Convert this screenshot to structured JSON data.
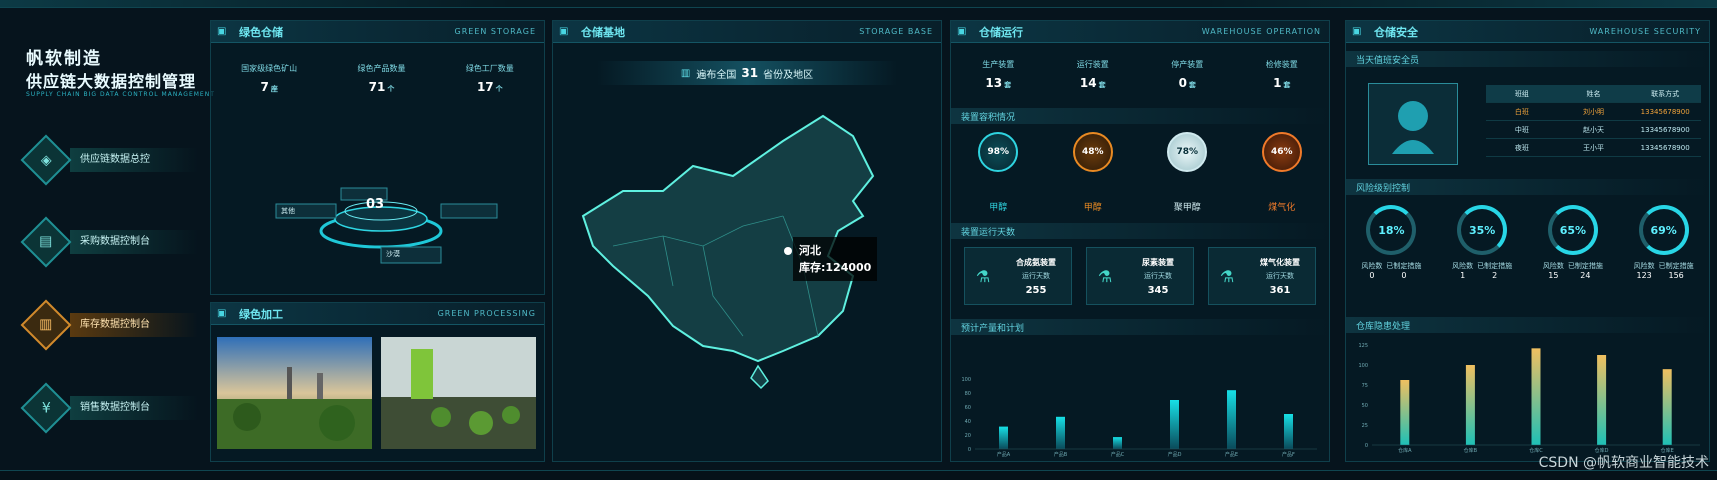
{
  "brand": {
    "name": "帆软制造",
    "title": "供应链大数据控制管理",
    "subtitle": "SUPPLY CHAIN BIG DATA CONTROL MANAGEMENT"
  },
  "nav": [
    {
      "label": "供应链数据总控",
      "icon": "shield-icon",
      "glyph": "◈",
      "active": false
    },
    {
      "label": "采购数据控制台",
      "icon": "document-icon",
      "glyph": "▤",
      "active": false
    },
    {
      "label": "库存数据控制台",
      "icon": "warehouse-icon",
      "glyph": "▥",
      "active": true
    },
    {
      "label": "销售数据控制台",
      "icon": "currency-icon",
      "glyph": "¥",
      "active": false
    }
  ],
  "green_storage": {
    "title": "绿色仓储",
    "title_en": "GREEN STORAGE",
    "stats": [
      {
        "label": "国家级绿色矿山",
        "value": "7",
        "unit": "座"
      },
      {
        "label": "绿色产品数量",
        "value": "71",
        "unit": "个"
      },
      {
        "label": "绿色工厂数量",
        "value": "17",
        "unit": "个"
      }
    ],
    "center_value": "03",
    "tag_left": "其他",
    "tag_right": "",
    "tag_bottom": "沙漠"
  },
  "green_processing": {
    "title": "绿色加工",
    "title_en": "GREEN PROCESSING"
  },
  "storage_base": {
    "title": "仓储基地",
    "title_en": "STORAGE BASE",
    "coverage_prefix": "遍布全国",
    "coverage_count": "31",
    "coverage_suffix": "省份及地区",
    "tooltip_region": "河北",
    "tooltip_stock": "库存:124000"
  },
  "operation": {
    "title": "仓储运行",
    "title_en": "WAREHOUSE OPERATION",
    "stats": [
      {
        "label": "生产装置",
        "value": "13",
        "unit": "套"
      },
      {
        "label": "运行装置",
        "value": "14",
        "unit": "套"
      },
      {
        "label": "停产装置",
        "value": "0",
        "unit": "套"
      },
      {
        "label": "检修装置",
        "value": "1",
        "unit": "套"
      }
    ],
    "capacity_title": "装置容积情况",
    "capacity": [
      {
        "label": "甲醇",
        "pct": "98%",
        "color": "#2fd3df"
      },
      {
        "label": "甲醇",
        "pct": "48%",
        "color": "#e98a23"
      },
      {
        "label": "聚甲醇",
        "pct": "78%",
        "color": "#cfe9ee"
      },
      {
        "label": "煤气化",
        "pct": "46%",
        "color": "#f07a2a"
      }
    ],
    "running_title": "装置运行天数",
    "running": [
      {
        "name": "合成氨装置",
        "label": "运行天数",
        "value": "255"
      },
      {
        "name": "尿素装置",
        "label": "运行天数",
        "value": "345"
      },
      {
        "name": "煤气化装置",
        "label": "运行天数",
        "value": "361"
      }
    ],
    "plan_title": "预计产量和计划"
  },
  "safety": {
    "title": "仓储安全",
    "title_en": "WAREHOUSE SECURITY",
    "officer_title": "当天值班安全员",
    "table_headers": [
      "班组",
      "姓名",
      "联系方式"
    ],
    "table_rows": [
      [
        "白班",
        "刘小明",
        "13345678900"
      ],
      [
        "中班",
        "赵小天",
        "13345678900"
      ],
      [
        "夜班",
        "王小平",
        "13345678900"
      ]
    ],
    "risk_title": "风险级别控制",
    "rings": [
      {
        "pct": "18%",
        "a_label": "风险数",
        "a_val": "0",
        "b_label": "已制定措施",
        "b_val": "0"
      },
      {
        "pct": "35%",
        "a_label": "风险数",
        "a_val": "1",
        "b_label": "已制定措施",
        "b_val": "2"
      },
      {
        "pct": "65%",
        "a_label": "风险数",
        "a_val": "15",
        "b_label": "已制定措施",
        "b_val": "24"
      },
      {
        "pct": "69%",
        "a_label": "风险数",
        "a_val": "123",
        "b_label": "已制定措施",
        "b_val": "156"
      }
    ],
    "hazard_title": "仓库隐患处理"
  },
  "chart_data": [
    {
      "type": "bar",
      "title": "预计产量和计划",
      "categories": [
        "产品A",
        "产品B",
        "产品C",
        "产品D",
        "产品E",
        "产品F"
      ],
      "values": [
        32,
        46,
        17,
        70,
        84,
        50
      ],
      "ylim": [
        0,
        100
      ],
      "yticks": [
        "0",
        "20",
        "40",
        "60",
        "80",
        "100"
      ]
    },
    {
      "type": "bar",
      "title": "仓库隐患处理",
      "categories": [
        "仓库A",
        "仓库B",
        "仓库C",
        "仓库D",
        "仓库E"
      ],
      "values": [
        78,
        96,
        116,
        108,
        91
      ],
      "ylim": [
        0,
        120
      ],
      "yticks": [
        "0",
        "25",
        "50",
        "75",
        "100",
        "125"
      ]
    }
  ],
  "watermark": "CSDN @帆软商业智能技术",
  "colors": {
    "accent": "#3fd9e6",
    "active": "#d18a2c",
    "bar": "#18b5c0"
  }
}
